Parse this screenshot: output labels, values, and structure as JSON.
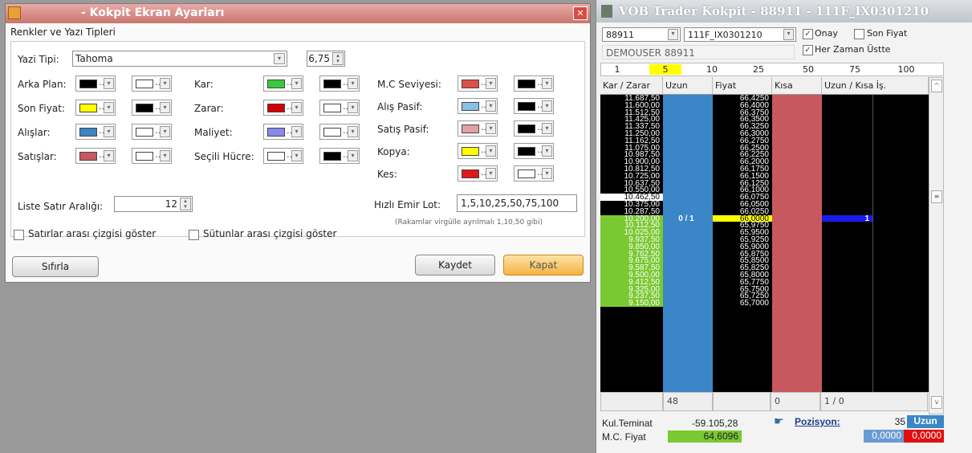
{
  "dialog": {
    "title": "- Kokpit Ekran Ayarları",
    "section": "Renkler ve Yazı Tipleri",
    "font_label": "Yazi Tipi:",
    "font_value": "Tahoma",
    "font_size": "6,75",
    "rows_left": [
      {
        "label": "Arka Plan:",
        "c1": "#000000",
        "c2": "#ffffff"
      },
      {
        "label": "Son Fiyat:",
        "c1": "#ffff00",
        "c2": "#000000"
      },
      {
        "label": "Alışlar:",
        "c1": "#3c84c4",
        "c2": "#ffffff"
      },
      {
        "label": "Satışlar:",
        "c1": "#c8585f",
        "c2": "#ffffff"
      }
    ],
    "rows_mid": [
      {
        "label": "Kar:",
        "c1": "#3cc83c",
        "c2": "#000000"
      },
      {
        "label": "Zarar:",
        "c1": "#d00000",
        "c2": "#ffffff"
      },
      {
        "label": "Maliyet:",
        "c1": "#8888ee",
        "c2": "#ffffff"
      },
      {
        "label": "Seçili Hücre:",
        "c1": "#ffffff",
        "c2": "#000000"
      }
    ],
    "rows_right": [
      {
        "label": "M.C Seviyesi:",
        "c1": "#e0504a",
        "c2": "#000000"
      },
      {
        "label": "Alış Pasif:",
        "c1": "#88c0e6",
        "c2": "#000000"
      },
      {
        "label": "Satış Pasif:",
        "c1": "#e0a0a4",
        "c2": "#000000"
      },
      {
        "label": "Kopya:",
        "c1": "#ffff00",
        "c2": "#000000"
      },
      {
        "label": "Kes:",
        "c1": "#e01818",
        "c2": "#ffffff"
      }
    ],
    "row_spacing_label": "Liste Satır Aralığı:",
    "row_spacing_value": "12",
    "lot_label": "Hızlı Emir Lot:",
    "lot_value": "1,5,10,25,50,75,100",
    "lot_hint": "(Rakamlar virgülle ayrılmalı 1,10,50 gibi)",
    "check_rows": "Satırlar arası çizgisi göster",
    "check_cols": "Sütunlar arası çizgisi göster",
    "reset": "Sıfırla",
    "save": "Kaydet",
    "close": "Kapat"
  },
  "trader": {
    "title": "VOB Trader Kokpit - 88911 - 111F_IX0301210",
    "account": "88911",
    "contract": "111F_IX0301210",
    "onay": "Onay",
    "son_fiyat": "Son Fiyat",
    "user": "DEMOUSER 88911",
    "always_on_top": "Her Zaman Üstte",
    "lots": [
      "1",
      "5",
      "10",
      "25",
      "50",
      "75",
      "100"
    ],
    "headers": [
      "Kar / Zarar",
      "Uzun",
      "Fiyat",
      "Kısa",
      "Uzun / Kısa İş."
    ],
    "pnl": [
      "11.687,50",
      "11.600,00",
      "11.512,50",
      "11.425,00",
      "11.337,50",
      "11.250,00",
      "11.162,50",
      "11.075,00",
      "10.987,50",
      "10.900,00",
      "10.812,50",
      "10.725,00",
      "10.637,50",
      "10.550,00",
      "10.462,50",
      "10.375,00",
      "10.287,50",
      "10.200,00",
      "10.112,50",
      "10.025,00",
      "9.937,50",
      "9.850,00",
      "9.762,50",
      "9.675,00",
      "9.587,50",
      "9.500,00",
      "9.412,50",
      "9.325,00",
      "9.237,50",
      "9.150,00"
    ],
    "prices": [
      "66,4250",
      "66,4000",
      "66,3750",
      "66,3500",
      "66,3250",
      "66,3000",
      "66,2750",
      "66,2500",
      "66,2250",
      "66,2000",
      "66,1750",
      "66,1500",
      "66,1250",
      "66,1000",
      "66,0750",
      "66,0500",
      "66,0250",
      "66,0000",
      "65,9750",
      "65,9500",
      "65,9250",
      "65,9000",
      "65,8750",
      "65,8500",
      "65,8250",
      "65,8000",
      "65,7750",
      "65,7500",
      "65,7250",
      "65,7000"
    ],
    "current_uzun": "0 / 1",
    "current_pos": "1",
    "footer_uzun": "48",
    "footer_kisa": "0",
    "footer_is": "1 / 0",
    "kul_teminat_label": "Kul.Teminat",
    "kul_teminat": "-59.105,28",
    "mc_label": "M.C. Fiyat",
    "mc_value": "64,6096",
    "pozisyon_label": "Pozisyon:",
    "pozisyon_value": "35",
    "pozisyon_side": "Uzun",
    "val_blue": "0,0000",
    "val_red": "0,0000",
    "colors": {
      "long": "#3a86c6",
      "short": "#c8585f",
      "profit_bg": "#7ac832",
      "last_price": "#ffff00"
    }
  }
}
